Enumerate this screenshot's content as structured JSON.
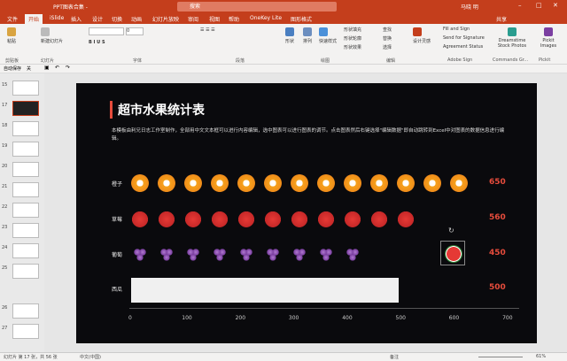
{
  "app": {
    "doc_title": "PPT图表合集 -",
    "search_placeholder": "搜索",
    "user": "马晓 明",
    "share": "共享"
  },
  "tabs": [
    "文件",
    "开始",
    "iSlide",
    "插入",
    "设计",
    "切换",
    "动画",
    "幻灯片放映",
    "审阅",
    "视图",
    "帮助",
    "OneKey Lite",
    "图形格式"
  ],
  "ribbon": {
    "clipboard": "剪贴板",
    "slides": "幻灯片",
    "font": "字体",
    "paragraph": "段落",
    "drawing": "绘图",
    "editing": "编辑",
    "adobe_sign": "Adobe Sign",
    "commands_group": "Commands Gr...",
    "pickit_group": "Pickit",
    "paste": "粘贴",
    "new_slide": "新建幻灯片",
    "font_size": "0",
    "shapes": "形状",
    "arrange": "排列",
    "quick_styles": "快速样式",
    "shape_fill": "形状填充",
    "shape_outline": "形状轮廓",
    "shape_effects": "形状效果",
    "find": "查找",
    "replace": "替换",
    "select": "选择",
    "design_ideas": "设计灵感",
    "fill_sign": "Fill and Sign",
    "send_sign": "Send for Signature",
    "agreement": "Agreement Status",
    "dreamstime": "Dreamstime Stock Photos",
    "pickit": "Pickit Images"
  },
  "qat": {
    "autosave": "自动保存",
    "off": "关"
  },
  "thumbs": [
    "15",
    "16",
    "17",
    "18",
    "19",
    "20",
    "21",
    "22",
    "23",
    "24",
    "25",
    "26",
    "27",
    "28"
  ],
  "slide": {
    "title": "超市水果统计表",
    "desc": "本模板由利兄日志工作室制作，全部用中文文本框可以进行内容编辑，选中图表可以进行图表的调节。点击图表然后右键选择\"编辑数据\"即自动跳转到Excel中对图表的数据信息进行编辑。"
  },
  "chart_data": {
    "type": "bar",
    "categories": [
      "橙子",
      "草莓",
      "葡萄",
      "西瓜"
    ],
    "values": [
      650,
      560,
      450,
      500
    ],
    "xlim": [
      0,
      700
    ],
    "xticks": [
      "0",
      "100",
      "200",
      "300",
      "400",
      "500",
      "600",
      "700"
    ]
  },
  "colors": {
    "accent": "#e74c3c",
    "ribbon": "#c43e1c",
    "slide_bg": "#0a0a0d"
  },
  "status": {
    "slide": "幻灯片 第 17 张，共 56 张",
    "lang": "中文(中国)",
    "notes": "备注",
    "zoom": "61%"
  }
}
